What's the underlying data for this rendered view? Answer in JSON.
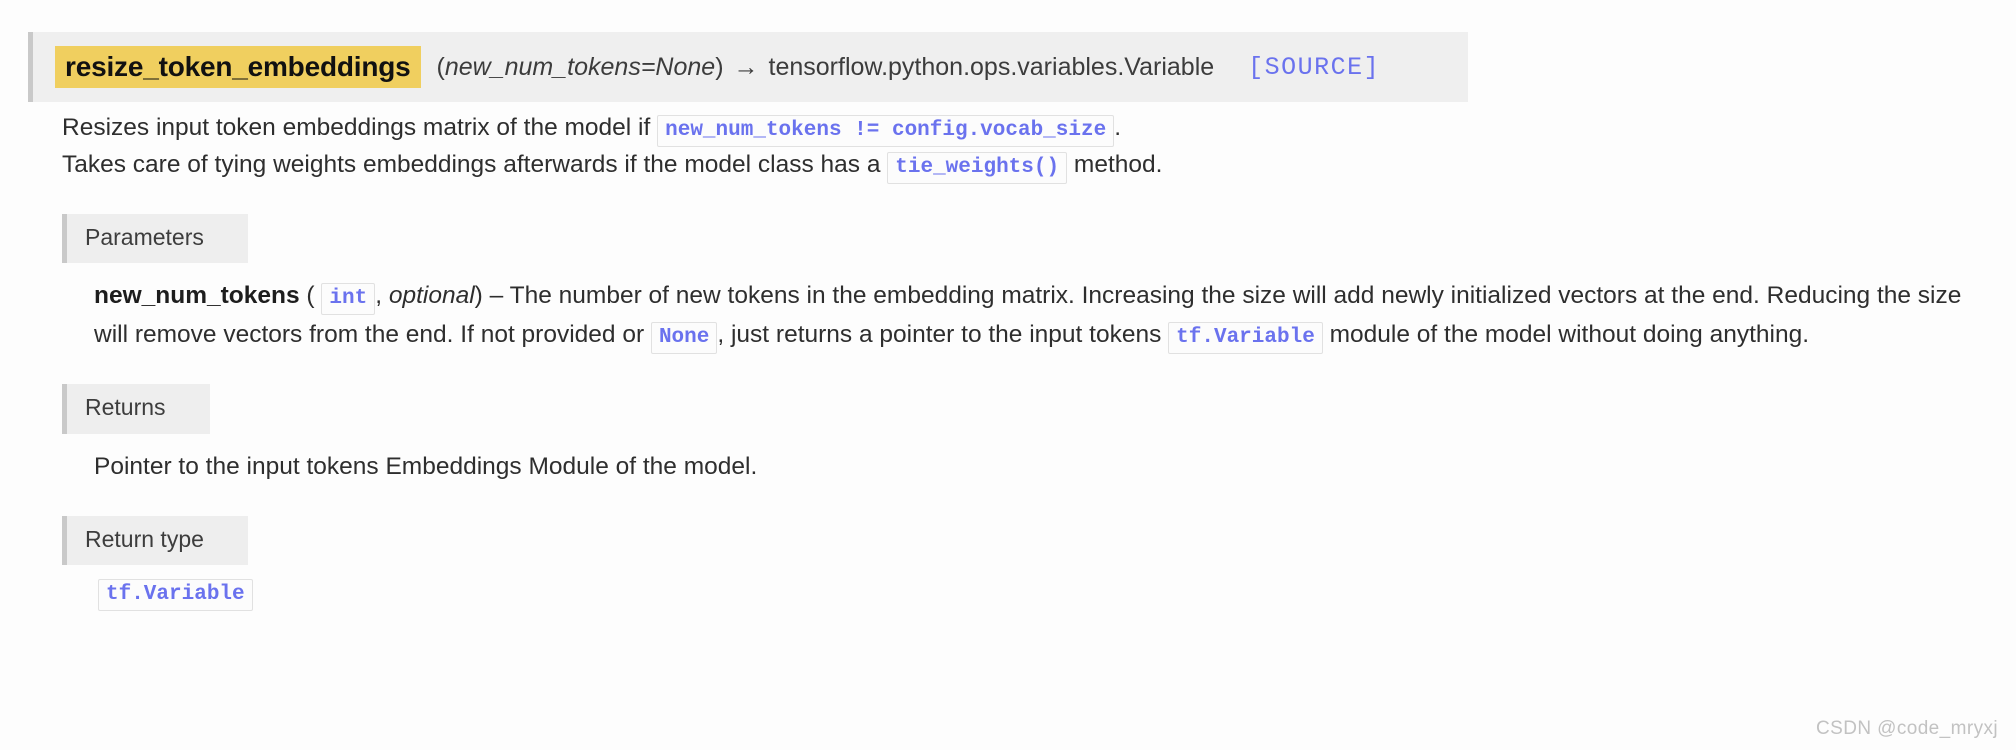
{
  "signature": {
    "method_name": "resize_token_embeddings",
    "open_paren": "(",
    "params": "new_num_tokens=None",
    "close_paren": ")",
    "arrow": "→",
    "return_type": "tensorflow.python.ops.variables.Variable",
    "source_link": "[SOURCE]"
  },
  "paragraphs": {
    "p1_before": "Resizes input token embeddings matrix of the model if",
    "p1_code": "new_num_tokens != config.vocab_size",
    "p1_after": ".",
    "p2_before": "Takes care of tying weights embeddings afterwards if the model class has a",
    "p2_code": "tie_weights()",
    "p2_after": "method."
  },
  "parameters": {
    "label": "Parameters",
    "name": "new_num_tokens",
    "open_paren": "(",
    "type_code": "int",
    "comma": ",",
    "optional": "optional",
    "close_paren": ")",
    "dash": "–",
    "desc_1": "The number of new tokens in the embedding matrix. Increasing the size will add newly initialized vectors at the end. Reducing the size will remove vectors from the end. If not provided or",
    "none_code": "None",
    "desc_2": ", just returns a pointer to the input tokens",
    "variable_code": "tf.Variable",
    "desc_3": "module of the model without doing anything."
  },
  "returns": {
    "label": "Returns",
    "text": "Pointer to the input tokens Embeddings Module of the model."
  },
  "return_type": {
    "label": "Return type",
    "code": "tf.Variable"
  },
  "watermark": "CSDN @code_mryxj",
  "colors": {
    "code_text": "#6a72ee",
    "highlight": "#f0cf5f",
    "header_bg": "#efefef",
    "accent_bar": "#c9c9c9",
    "source_link": "#6a72ee"
  }
}
